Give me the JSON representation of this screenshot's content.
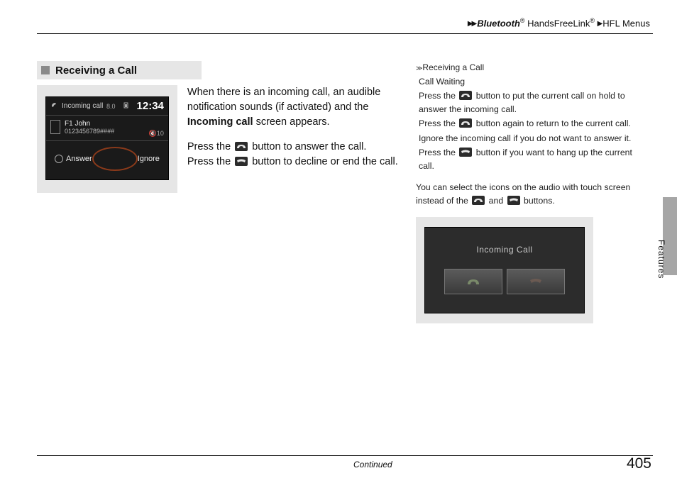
{
  "breadcrumb": {
    "bluetooth": "Bluetooth",
    "hfl": "HandsFreeLink",
    "menus": "HFL Menus"
  },
  "section_title": "Receiving a Call",
  "body": {
    "p1a": "When there is an incoming call, an audible notification sounds (if activated) and the ",
    "p1b": "Incoming call",
    "p1c": " screen appears.",
    "p2": "Press the ",
    "p2b": " button to answer the call.",
    "p3": "Press the ",
    "p3b": " button to decline or end the call."
  },
  "device1": {
    "status": "Incoming call",
    "clock": "12:34",
    "signal_label": "8.0",
    "volume_label": "10",
    "name": "F1 John",
    "number": "0123456789####",
    "answer": "Answer",
    "ignore": "Ignore"
  },
  "sidebar": {
    "header": "Receiving a Call",
    "call_waiting": "Call Waiting",
    "l1a": "Press the ",
    "l1b": " button to put the current call on hold to answer the incoming call.",
    "l2a": "Press the ",
    "l2b": " button again to return to the current call.",
    "l3": "Ignore the incoming call if you do not want to answer it.",
    "l4a": "Press the ",
    "l4b": " button if you want to hang up the current call.",
    "l5a": "You can select the icons on the audio with touch screen instead of the ",
    "l5mid": " and ",
    "l5b": " buttons."
  },
  "device2": {
    "title": "Incoming Call"
  },
  "tab_label": "Features",
  "continued": "Continued",
  "page_number": "405"
}
